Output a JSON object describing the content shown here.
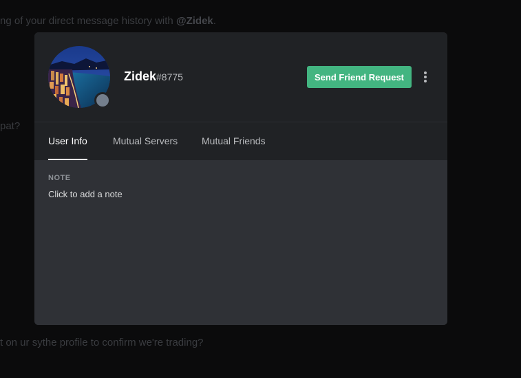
{
  "background": {
    "top_line_prefix": "ng of your direct message history with ",
    "top_line_mention": "@Zidek",
    "top_line_suffix": ".",
    "side_text": "pat?",
    "bottom_line": "t on ur sythe profile to confirm we're trading?"
  },
  "profile": {
    "username": "Zidek",
    "discriminator": "#8775",
    "status": "offline",
    "status_color": "#747f8d"
  },
  "actions": {
    "friend_request_label": "Send Friend Request",
    "friend_request_color": "#43b581",
    "more_icon": "kebab-menu-icon"
  },
  "tabs": [
    {
      "label": "User Info",
      "active": true
    },
    {
      "label": "Mutual Servers",
      "active": false
    },
    {
      "label": "Mutual Friends",
      "active": false
    }
  ],
  "note": {
    "heading": "NOTE",
    "placeholder": "Click to add a note"
  },
  "colors": {
    "header_bg": "#202225",
    "body_bg": "#2f3136",
    "page_bg": "#0b0b0c"
  }
}
